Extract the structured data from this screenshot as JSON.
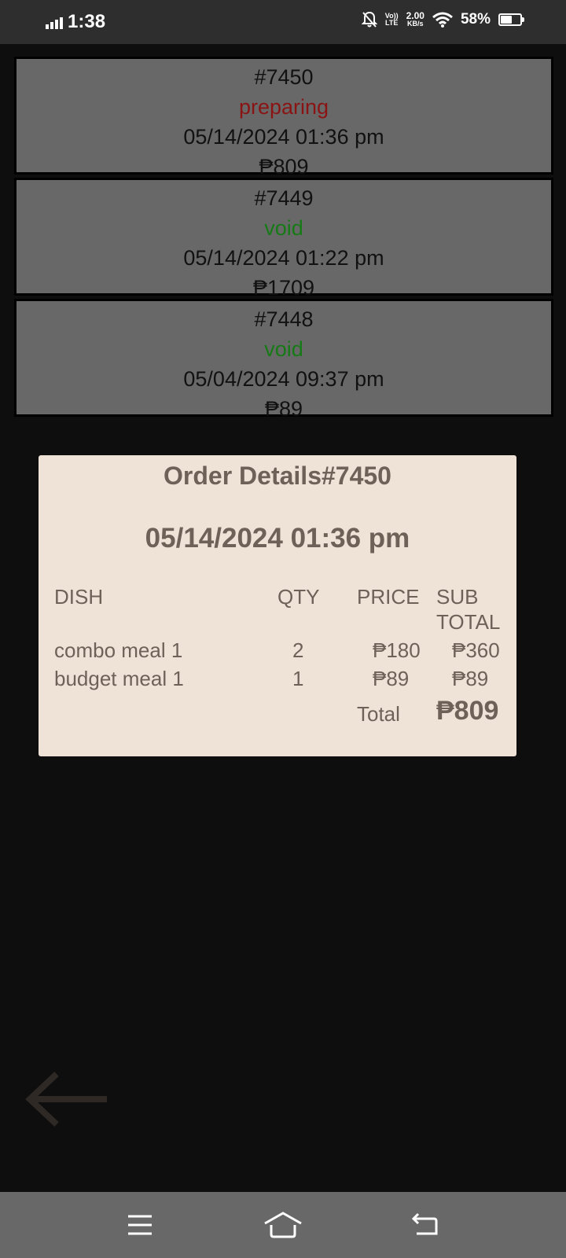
{
  "status_bar": {
    "time": "1:38",
    "lte_top": "Vo))",
    "lte_bottom": "LTE",
    "speed_value": "2.00",
    "speed_unit": "KB/s",
    "battery": "58%",
    "battery_level": 0.58,
    "icons": [
      "signal-icon",
      "notifications-off-icon",
      "lte-icon",
      "wifi-icon",
      "battery-icon"
    ]
  },
  "orders": [
    {
      "number": "#7450",
      "status": "preparing",
      "datetime": "05/14/2024 01:36 pm",
      "total": "₱809"
    },
    {
      "number": "#7449",
      "status": "void",
      "datetime": "05/14/2024 01:22 pm",
      "total": "₱1709"
    },
    {
      "number": "#7448",
      "status": "void",
      "datetime": "05/04/2024 09:37 pm",
      "total": "₱89"
    }
  ],
  "colors": {
    "status_preparing": "#8a1414",
    "status_void": "#167a16",
    "details_background": "#efe2d7",
    "details_text": "#6e6258"
  },
  "details": {
    "title": "Order Details#7450",
    "datetime": "05/14/2024 01:36 pm",
    "headers": {
      "dish": "DISH",
      "qty": "QTY",
      "price": "PRICE",
      "subtotal_line1": "SUB",
      "subtotal_line2": "TOTAL"
    },
    "items": [
      {
        "dish": "combo meal 1",
        "qty": "2",
        "price": "₱180",
        "subtotal": "₱360"
      },
      {
        "dish": "budget meal 1",
        "qty": "1",
        "price": "₱89",
        "subtotal": "₱89"
      }
    ],
    "total_label": "Total",
    "total_value": "₱809"
  },
  "back_button": {
    "icon": "arrow-left-icon"
  },
  "nav_bar": {
    "icons": [
      "menu-icon",
      "home-icon",
      "back-icon"
    ]
  }
}
